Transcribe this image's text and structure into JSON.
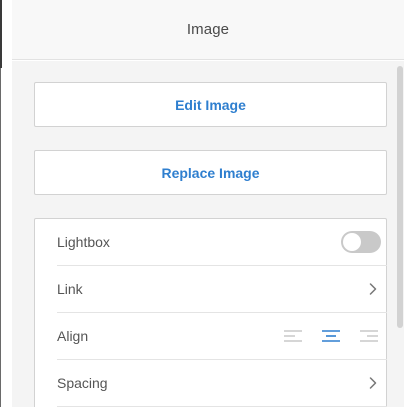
{
  "header": {
    "title": "Image"
  },
  "buttons": {
    "edit_label": "Edit Image",
    "replace_label": "Replace Image"
  },
  "settings": {
    "lightbox": {
      "label": "Lightbox",
      "enabled": false
    },
    "link": {
      "label": "Link",
      "icon": "chevron-right-icon"
    },
    "align": {
      "label": "Align",
      "options": [
        "align-left-icon",
        "align-center-icon",
        "align-right-icon"
      ],
      "selected": "center"
    },
    "spacing": {
      "label": "Spacing",
      "icon": "chevron-right-icon"
    }
  },
  "colors": {
    "accent": "#2f7fcf",
    "inactive_icon": "#c8c8c8",
    "toggle_off": "#c9c9c9"
  }
}
